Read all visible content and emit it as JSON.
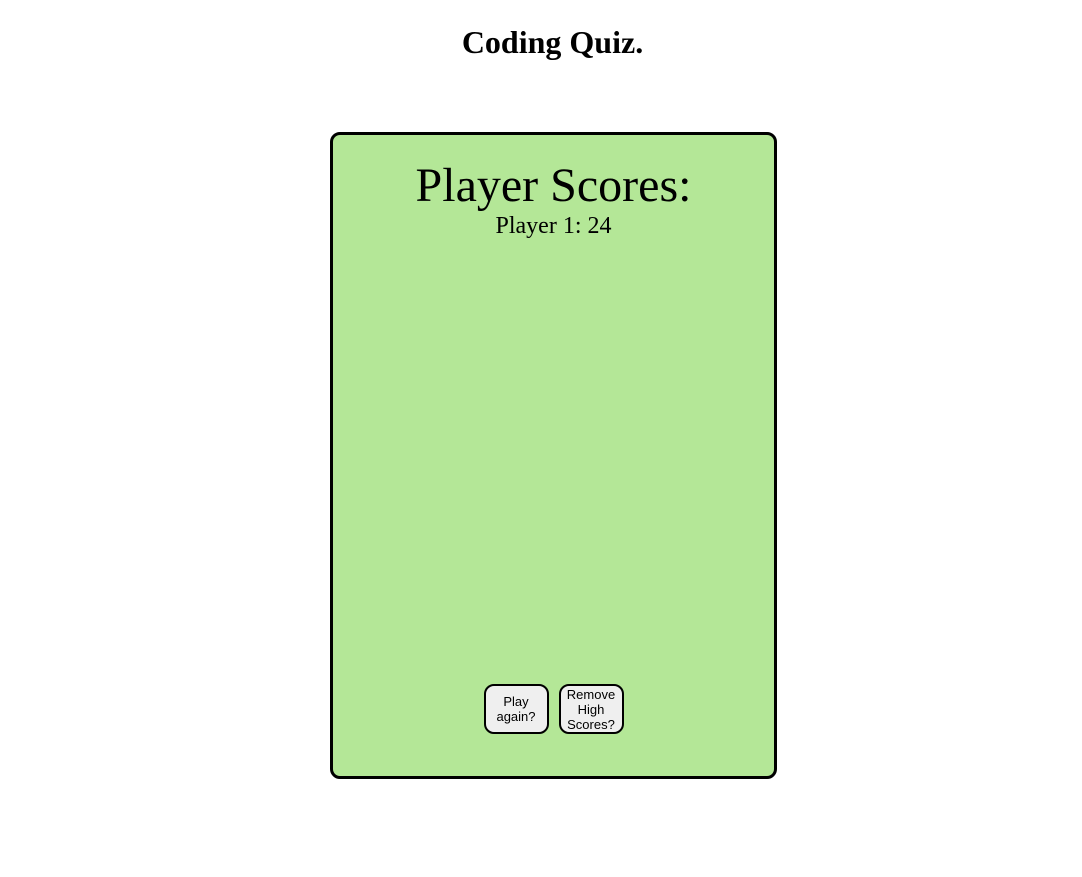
{
  "header": {
    "title": "Coding Quiz."
  },
  "scoreboard": {
    "heading": "Player Scores:",
    "entries": [
      {
        "text": "Player 1: 24"
      }
    ],
    "buttons": {
      "play_again_label": "Play again?",
      "remove_scores_label": "Remove High Scores?"
    }
  },
  "colors": {
    "card_background": "#b4e797",
    "card_border": "#000000",
    "button_background": "#efefef"
  }
}
